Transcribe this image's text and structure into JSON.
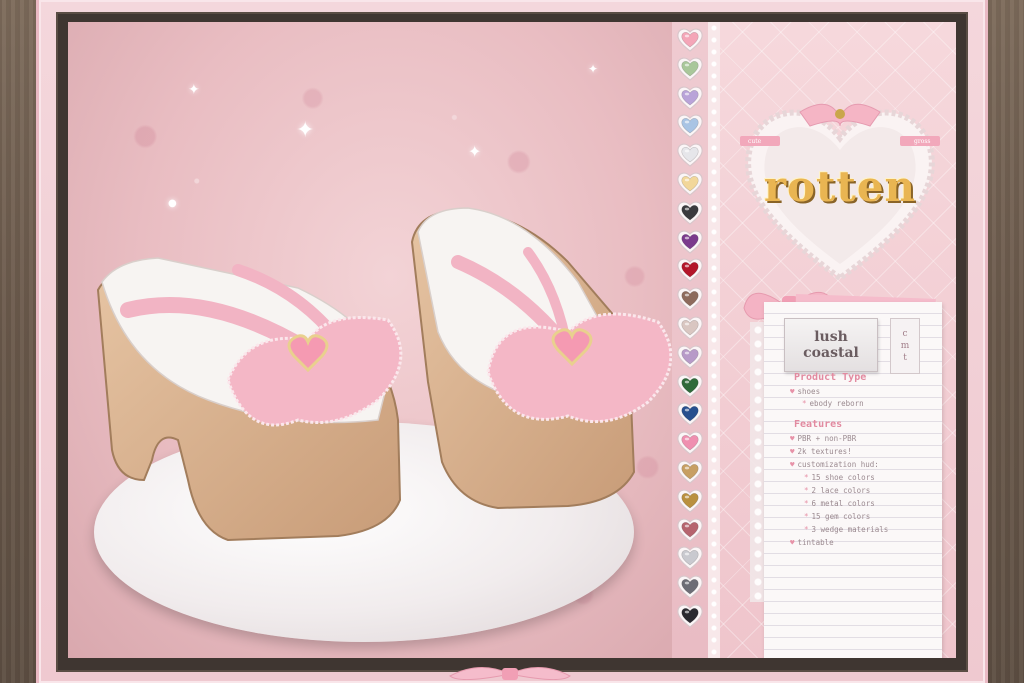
{
  "brand": {
    "logo": "rotten",
    "ribbon_left": "cute",
    "ribbon_right": "gross"
  },
  "product": {
    "name_line1": "lush",
    "name_line2": "coastal",
    "tags": [
      "c",
      "m",
      "t"
    ]
  },
  "product_type": {
    "title": "Product Type",
    "items": [
      {
        "text": "shoes",
        "level": 1
      },
      {
        "text": "ebody reborn",
        "level": 2
      }
    ]
  },
  "features": {
    "title": "Features",
    "items": [
      {
        "text": "PBR + non-PBR",
        "level": 1
      },
      {
        "text": "2k textures!",
        "level": 1
      },
      {
        "text": "customization hud:",
        "level": 1
      },
      {
        "text": "15 shoe colors",
        "level": 2
      },
      {
        "text": "2 lace colors",
        "level": 2
      },
      {
        "text": "6 metal colors",
        "level": 2
      },
      {
        "text": "15 gem colors",
        "level": 2
      },
      {
        "text": "3 wedge materials",
        "level": 2
      },
      {
        "text": "tintable",
        "level": 1
      }
    ]
  },
  "swatch_colors": [
    "#f4a6b8",
    "#a9c79a",
    "#b9a3d8",
    "#a9c4e4",
    "#e6e6ea",
    "#f2d79a",
    "#3a3a3e",
    "#7b3a8c",
    "#b3162a",
    "#8d6a5c",
    "#d9c6c1",
    "#b79ac8",
    "#2f6a3a",
    "#274f8e",
    "#ef8fb0",
    "#c79f63",
    "#b9903f",
    "#b6646e",
    "#c9c9cf",
    "#6d6d76",
    "#2a2a30"
  ],
  "colors": {
    "accent_pink": "#e28aa0",
    "logo_gold": "#e9b552"
  }
}
